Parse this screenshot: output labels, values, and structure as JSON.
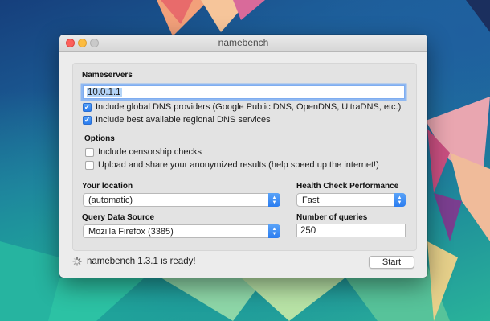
{
  "window": {
    "title": "namebench"
  },
  "nameservers": {
    "heading": "Nameservers",
    "field_value": "10.0.1.1",
    "include_global": {
      "label": "Include global DNS providers (Google Public DNS, OpenDNS, UltraDNS, etc.)",
      "checked": true
    },
    "include_regional": {
      "label": "Include best available regional DNS services",
      "checked": true
    }
  },
  "options": {
    "heading": "Options",
    "censorship": {
      "label": "Include censorship checks",
      "checked": false
    },
    "upload": {
      "label": "Upload and share your anonymized results (help speed up the internet!)",
      "checked": false
    }
  },
  "location": {
    "label": "Your location",
    "selected": "(automatic)"
  },
  "health_check": {
    "label": "Health Check Performance",
    "selected": "Fast"
  },
  "query_source": {
    "label": "Query Data Source",
    "selected": "Mozilla Firefox (3385)"
  },
  "queries": {
    "label": "Number of queries",
    "value": "250"
  },
  "status": {
    "text": "namebench 1.3.1 is ready!"
  },
  "buttons": {
    "start": "Start"
  },
  "colors": {
    "accent": "#2a7cf0",
    "close": "#fc605b",
    "minimize": "#fdbc40",
    "zoom_disabled": "#c9c9c9"
  }
}
